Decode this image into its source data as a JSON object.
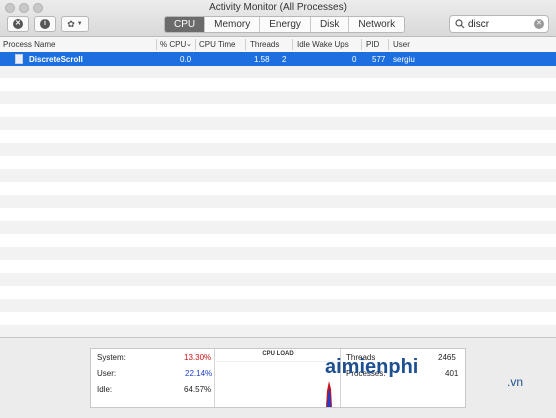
{
  "window": {
    "title": "Activity Monitor (All Processes)"
  },
  "tabs": [
    "CPU",
    "Memory",
    "Energy",
    "Disk",
    "Network"
  ],
  "search": {
    "value": "discr"
  },
  "columns": [
    "Process Name",
    "% CPU",
    "CPU Time",
    "Threads",
    "Idle Wake Ups",
    "PID",
    "User"
  ],
  "process": {
    "name": "DiscreteScroll",
    "cpu": "0.0",
    "cpu_time": "1.58",
    "threads": "2",
    "idle_wake_ups": "0",
    "pid": "577",
    "user": "sergiu"
  },
  "stats": {
    "system_label": "System:",
    "system_value": "13.30%",
    "user_label": "User:",
    "user_value": "22.14%",
    "idle_label": "Idle:",
    "idle_value": "64.57%",
    "graph_title": "CPU LOAD",
    "threads_label": "Threads",
    "threads_value": "2465",
    "processes_label": "Processes:",
    "processes_value": "401"
  },
  "colors": {
    "selection": "#1d6fe0",
    "system": "#d01010",
    "user": "#1a3fd0"
  },
  "watermark": {
    "text": "aimienphi",
    "suffix": ".vn"
  }
}
